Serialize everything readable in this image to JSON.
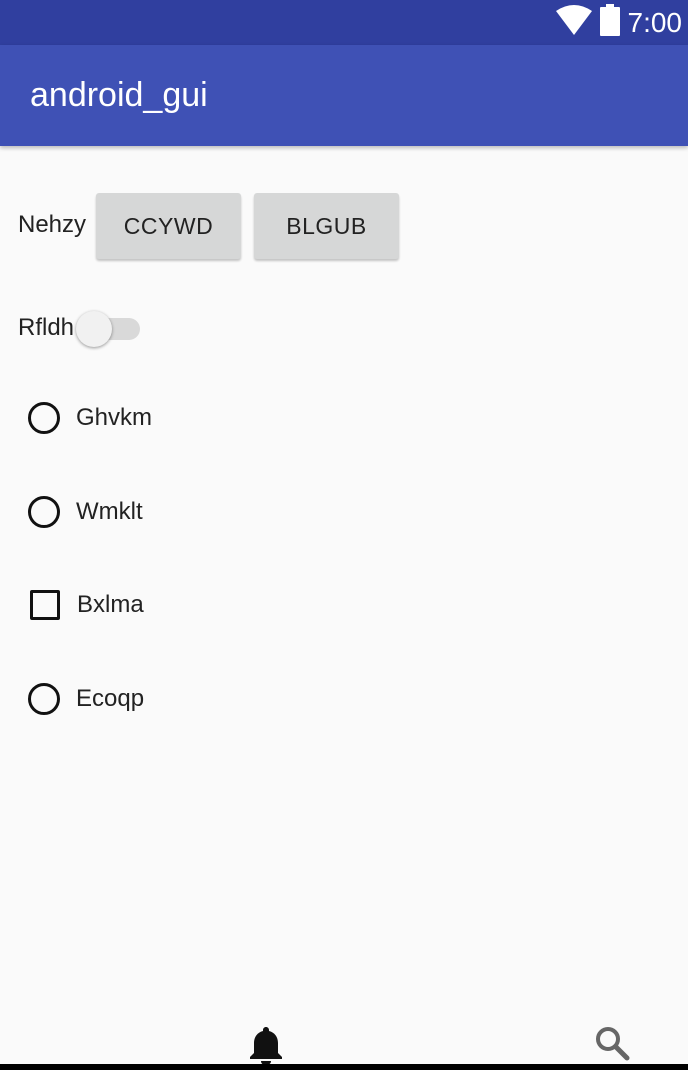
{
  "status_bar": {
    "time": "7:00",
    "wifi_icon": "wifi-icon",
    "battery_icon": "battery-icon"
  },
  "app_bar": {
    "title": "android_gui"
  },
  "controls": {
    "nehzy_label": "Nehzy",
    "button_ccywd": "CCYWD",
    "button_blgub": "BLGUB",
    "switch_label": "Rfldh",
    "switch_on": false
  },
  "options": [
    {
      "type": "radio",
      "label": "Ghvkm",
      "checked": false
    },
    {
      "type": "radio",
      "label": "Wmklt",
      "checked": false
    },
    {
      "type": "checkbox",
      "label": "Bxlma",
      "checked": false
    },
    {
      "type": "radio",
      "label": "Ecoqp",
      "checked": false
    }
  ],
  "bottom_nav": {
    "items": [
      {
        "icon": "bell-icon"
      },
      {
        "icon": "search-icon"
      }
    ]
  },
  "colors": {
    "status_bar": "#303f9f",
    "app_bar": "#3f51b5",
    "background": "#fafafa",
    "button": "#d6d7d7"
  }
}
